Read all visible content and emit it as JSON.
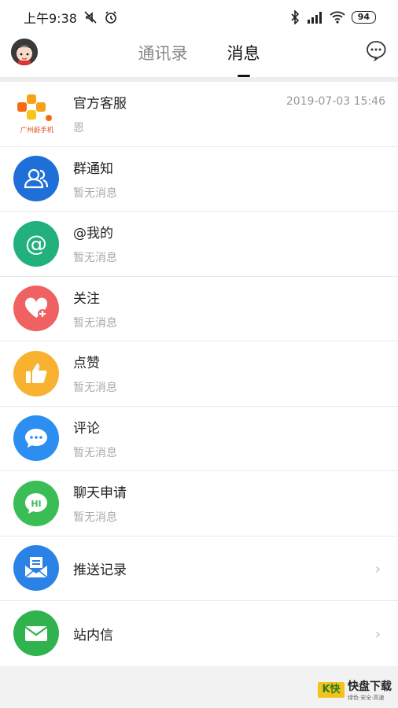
{
  "status": {
    "time": "上午9:38",
    "battery": "94"
  },
  "header": {
    "tabs": [
      {
        "label": "通讯录",
        "active": false
      },
      {
        "label": "消息",
        "active": true
      }
    ]
  },
  "list": [
    {
      "title": "官方客服",
      "subtitle": "恩",
      "time": "2019-07-03 15:46",
      "icon": "logo",
      "logo_text": "广州蔚手机"
    },
    {
      "title": "群通知",
      "subtitle": "暂无消息",
      "icon": "group-icon",
      "color": "#1f6fd8"
    },
    {
      "title": "@我的",
      "subtitle": "暂无消息",
      "icon": "at-icon",
      "color": "#22b07d"
    },
    {
      "title": "关注",
      "subtitle": "暂无消息",
      "icon": "heart-plus-icon",
      "color": "#f06161"
    },
    {
      "title": "点赞",
      "subtitle": "暂无消息",
      "icon": "thumbs-up-icon",
      "color": "#f8b22f"
    },
    {
      "title": "评论",
      "subtitle": "暂无消息",
      "icon": "comment-icon",
      "color": "#2b8ef0"
    },
    {
      "title": "聊天申请",
      "subtitle": "暂无消息",
      "icon": "hi-bubble-icon",
      "color": "#3bbd56"
    },
    {
      "title": "推送记录",
      "icon": "push-inbox-icon",
      "color": "#2b82e6"
    },
    {
      "title": "站内信",
      "icon": "envelope-icon",
      "color": "#30b24e"
    }
  ],
  "watermark": {
    "brand": "快盘下载",
    "sub": "绿色·安全·高速"
  }
}
